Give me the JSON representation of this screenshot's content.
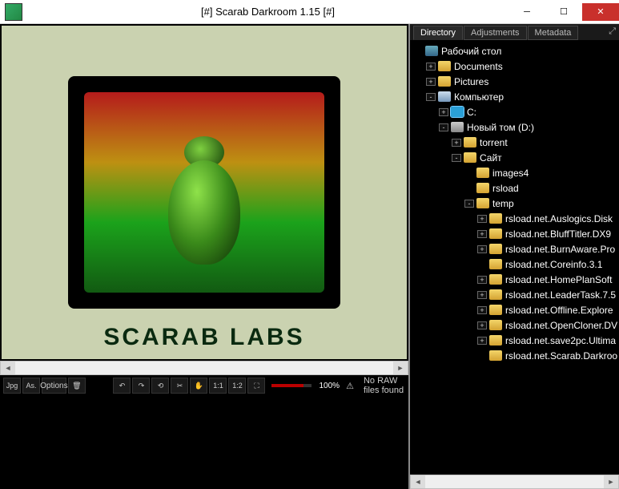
{
  "window": {
    "title": "[#] Scarab Darkroom 1.15 [#]"
  },
  "logo": {
    "text": "SCARAB LABS"
  },
  "tabs": {
    "directory": "Directory",
    "adjustments": "Adjustments",
    "metadata": "Metadata"
  },
  "tree": [
    {
      "depth": 0,
      "toggle": "",
      "icon": "desktop",
      "label": "Рабочий стол"
    },
    {
      "depth": 1,
      "toggle": "+",
      "icon": "folder",
      "label": "Documents"
    },
    {
      "depth": 1,
      "toggle": "+",
      "icon": "folder",
      "label": "Pictures"
    },
    {
      "depth": 1,
      "toggle": "-",
      "icon": "comp",
      "label": "Компьютер"
    },
    {
      "depth": 2,
      "toggle": "+",
      "icon": "drive-c",
      "label": "C:"
    },
    {
      "depth": 2,
      "toggle": "-",
      "icon": "drive",
      "label": "Новый том (D:)"
    },
    {
      "depth": 3,
      "toggle": "+",
      "icon": "folder",
      "label": "torrent"
    },
    {
      "depth": 3,
      "toggle": "-",
      "icon": "folder",
      "label": "Сайт"
    },
    {
      "depth": 4,
      "toggle": "",
      "icon": "folder",
      "label": "images4"
    },
    {
      "depth": 4,
      "toggle": "",
      "icon": "folder",
      "label": "rsload"
    },
    {
      "depth": 4,
      "toggle": "-",
      "icon": "folder",
      "label": "temp"
    },
    {
      "depth": 5,
      "toggle": "+",
      "icon": "folder",
      "label": "rsload.net.Auslogics.Disk"
    },
    {
      "depth": 5,
      "toggle": "+",
      "icon": "folder",
      "label": "rsload.net.BluffTitler.DX9"
    },
    {
      "depth": 5,
      "toggle": "+",
      "icon": "folder",
      "label": "rsload.net.BurnAware.Pro"
    },
    {
      "depth": 5,
      "toggle": "",
      "icon": "folder",
      "label": "rsload.net.Coreinfo.3.1"
    },
    {
      "depth": 5,
      "toggle": "+",
      "icon": "folder",
      "label": "rsload.net.HomePlanSoft"
    },
    {
      "depth": 5,
      "toggle": "+",
      "icon": "folder",
      "label": "rsload.net.LeaderTask.7.5"
    },
    {
      "depth": 5,
      "toggle": "+",
      "icon": "folder",
      "label": "rsload.net.Offline.Explore"
    },
    {
      "depth": 5,
      "toggle": "+",
      "icon": "folder",
      "label": "rsload.net.OpenCloner.DV"
    },
    {
      "depth": 5,
      "toggle": "+",
      "icon": "folder",
      "label": "rsload.net.save2pc.Ultima"
    },
    {
      "depth": 5,
      "toggle": "",
      "icon": "folder",
      "label": "rsload.net.Scarab.Darkroo"
    }
  ],
  "toolbar": {
    "jpg": "Jpg",
    "as": "As.",
    "options": "Options",
    "trash": "🗑",
    "undo": "↶",
    "redo": "↷",
    "rot": "⟲",
    "crop": "✂",
    "hand": "✋",
    "z11": "1:1",
    "z12": "1:2",
    "fit": "⛶",
    "zoom": "100%",
    "warn": "⚠",
    "status": "No RAW files found"
  }
}
